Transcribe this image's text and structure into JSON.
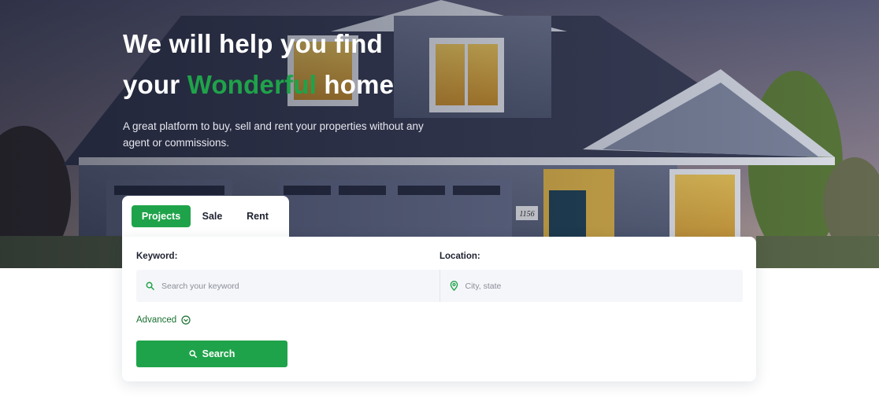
{
  "hero": {
    "headline_line1": "We will help you find",
    "headline_line2_before": "your ",
    "headline_accent": "Wonderful",
    "headline_line2_after": " home",
    "subtitle": "A great platform to buy, sell and rent your properties without any agent or commissions.",
    "house_number": "1156"
  },
  "tabs": [
    {
      "label": "Projects",
      "active": true
    },
    {
      "label": "Sale",
      "active": false
    },
    {
      "label": "Rent",
      "active": false
    }
  ],
  "search": {
    "keyword_label": "Keyword:",
    "keyword_placeholder": "Search your keyword",
    "location_label": "Location:",
    "location_placeholder": "City, state",
    "advanced_label": "Advanced",
    "button_label": "Search"
  },
  "icons": {
    "keyword": "search-icon",
    "location": "map-pin-icon",
    "advanced": "chevron-circle-down-icon",
    "button": "search-icon"
  },
  "colors": {
    "accent": "#1fa34a",
    "advanced_text": "#18702f"
  }
}
